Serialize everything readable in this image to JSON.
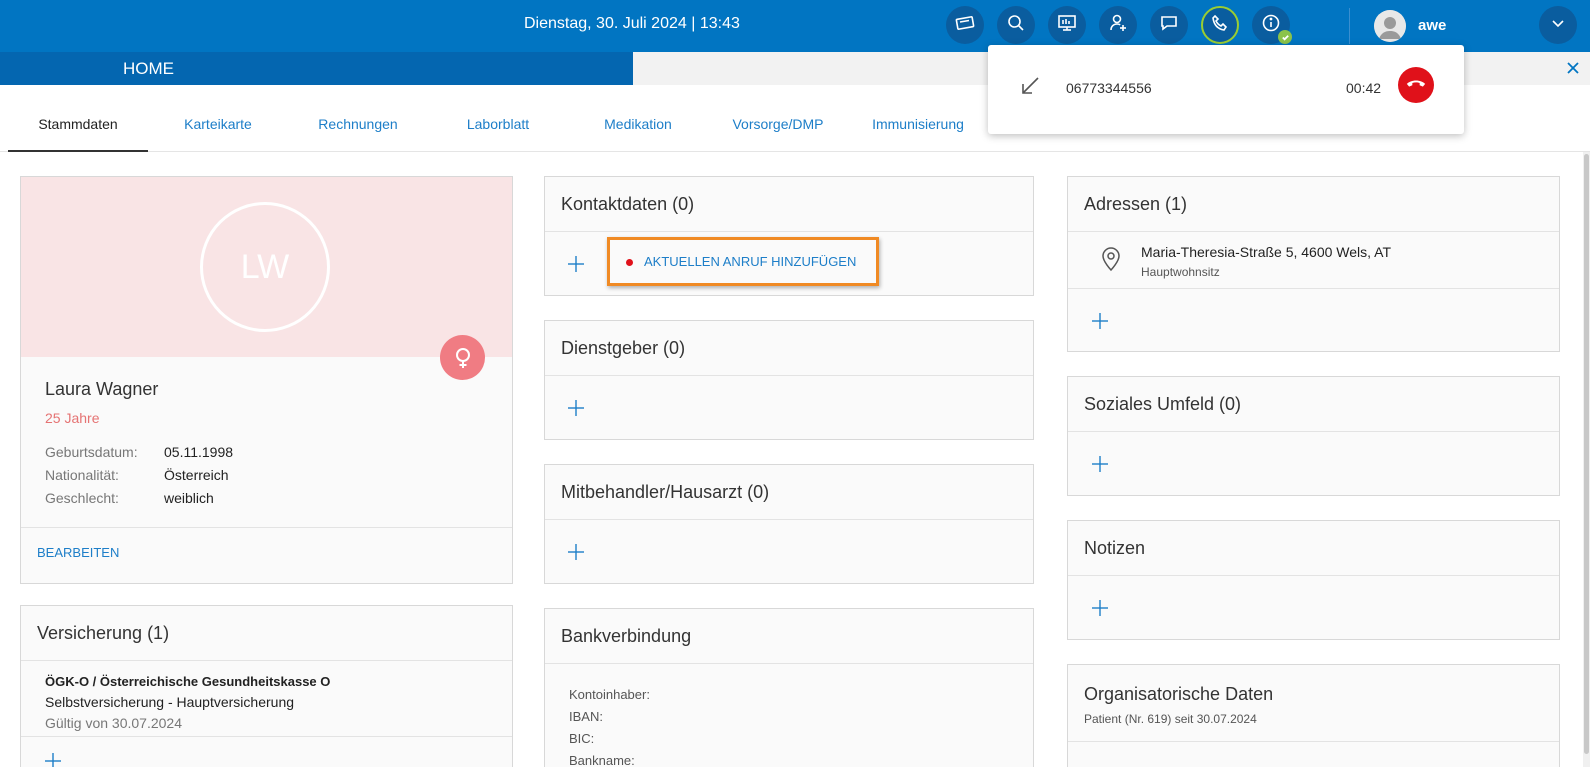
{
  "header": {
    "datetime": "Dienstag, 30. Juli 2024 | 13:43",
    "user_name": "awe",
    "icons": [
      "card-icon",
      "search-icon",
      "dashboard-icon",
      "add-user-icon",
      "chat-icon",
      "phone-icon",
      "info-icon"
    ],
    "accent": "#0175c2"
  },
  "tabs": {
    "home": "HOME"
  },
  "subnav": {
    "items": [
      "Stammdaten",
      "Karteikarte",
      "Rechnungen",
      "Laborblatt",
      "Medikation",
      "Vorsorge/DMP",
      "Immunisierung"
    ],
    "active": "Stammdaten"
  },
  "call": {
    "number": "06773344556",
    "timer": "00:42"
  },
  "patient": {
    "initials": "LW",
    "name": "Laura Wagner",
    "age": "25 Jahre",
    "birth_label": "Geburtsdatum:",
    "birth_value": "05.11.1998",
    "nationality_label": "Nationalität:",
    "nationality_value": "Österreich",
    "gender_label": "Geschlecht:",
    "gender_value": "weiblich",
    "edit": "BEARBEITEN"
  },
  "insurance": {
    "title": "Versicherung (1)",
    "provider": "ÖGK-O / Österreichische Gesundheitskasse O",
    "type": "Selbstversicherung - Hauptversicherung",
    "valid": "Gültig von 30.07.2024"
  },
  "contact": {
    "title": "Kontaktdaten (0)",
    "add_call": "AKTUELLEN ANRUF HINZUFÜGEN"
  },
  "employer": {
    "title": "Dienstgeber (0)"
  },
  "cotreater": {
    "title": "Mitbehandler/Hausarzt (0)"
  },
  "bank": {
    "title": "Bankverbindung",
    "owner_label": "Kontoinhaber:",
    "iban_label": "IBAN:",
    "bic_label": "BIC:",
    "bankname_label": "Bankname:"
  },
  "addresses": {
    "title": "Adressen (1)",
    "line": "Maria-Theresia-Straße 5, 4600 Wels, AT",
    "type": "Hauptwohnsitz"
  },
  "social": {
    "title": "Soziales Umfeld (0)"
  },
  "notes": {
    "title": "Notizen"
  },
  "org": {
    "title": "Organisatorische Daten",
    "sub": "Patient (Nr. 619) seit 30.07.2024"
  }
}
